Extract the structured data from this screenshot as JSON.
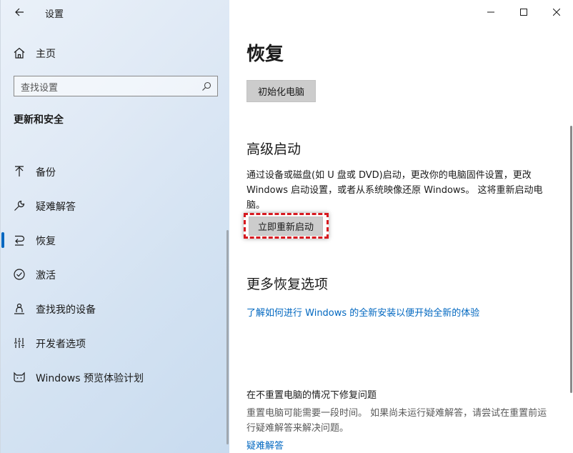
{
  "app": {
    "title": "设置"
  },
  "sidebar": {
    "home_label": "主页",
    "search_placeholder": "查找设置",
    "section_title": "更新和安全",
    "items": [
      {
        "label": "备份",
        "icon": "backup-arrow-icon"
      },
      {
        "label": "疑难解答",
        "icon": "wrench-icon"
      },
      {
        "label": "恢复",
        "icon": "recovery-icon",
        "selected": true
      },
      {
        "label": "激活",
        "icon": "check-circle-icon"
      },
      {
        "label": "查找我的设备",
        "icon": "person-location-icon"
      },
      {
        "label": "开发者选项",
        "icon": "developer-tools-icon"
      },
      {
        "label": "Windows 预览体验计划",
        "icon": "insider-cat-icon"
      }
    ]
  },
  "main": {
    "title": "恢复",
    "reset_button": "初始化电脑",
    "advanced_startup": {
      "heading": "高级启动",
      "description": "通过设备或磁盘(如 U 盘或 DVD)启动，更改你的电脑固件设置，更改 Windows 启动设置，或者从系统映像还原 Windows。 这将重新启动电脑。",
      "restart_button": "立即重新启动"
    },
    "more_options": {
      "heading": "更多恢复选项",
      "link": "了解如何进行 Windows 的全新安装以便开始全新的体验"
    },
    "fix_without_reset": {
      "heading": "在不重置电脑的情况下修复问题",
      "description": "重置电脑可能需要一段时间。 如果尚未运行疑难解答，请尝试在重置前运行疑难解答来解决问题。",
      "link": "疑难解答"
    }
  },
  "colors": {
    "accent": "#0067c0",
    "highlight": "#d71920"
  }
}
